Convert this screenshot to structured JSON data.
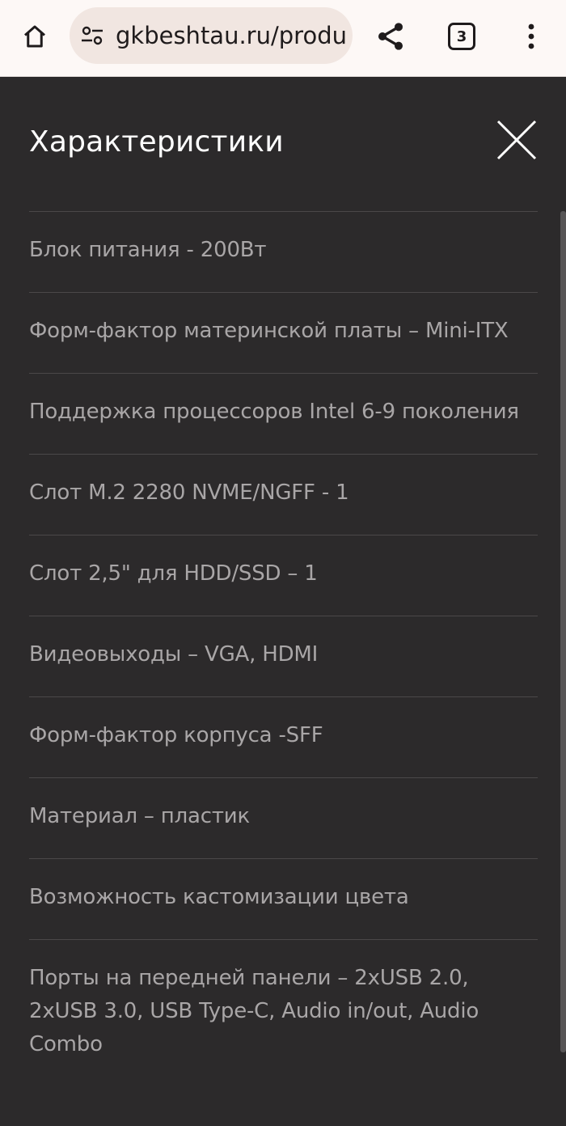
{
  "browser": {
    "url": "gkbeshtau.ru/produ",
    "tab_count": "3",
    "icons": {
      "home": "home-icon",
      "site_settings": "tune-icon",
      "share": "share-icon",
      "tabs": "tab-switcher-icon",
      "menu": "more-vert-icon"
    }
  },
  "panel": {
    "title": "Характеристики",
    "close_icon": "close-icon",
    "specs": [
      "Блок питания - 200Вт",
      "Форм-фактор материнской платы – Mini-ITX",
      "Поддержка процессоров Intel 6-9 поколения",
      "Слот M.2 2280 NVME/NGFF - 1",
      "Слот 2,5\" для HDD/SSD – 1",
      "Видеовыходы – VGA, HDMI",
      "Форм-фактор корпуса -SFF",
      "Материал – пластик",
      "Возможность кастомизации цвета",
      "Порты на передней панели – 2xUSB 2.0, 2xUSB 3.0, USB Type-C, Audio in/out, Audio Combo"
    ]
  },
  "colors": {
    "background": "#2c2a2b",
    "title": "#ffffff",
    "spec_text": "#a9a6a7",
    "divider": "#4b4849",
    "browser_bar": "#fdf8f6",
    "url_pill": "#f1e6e1"
  }
}
